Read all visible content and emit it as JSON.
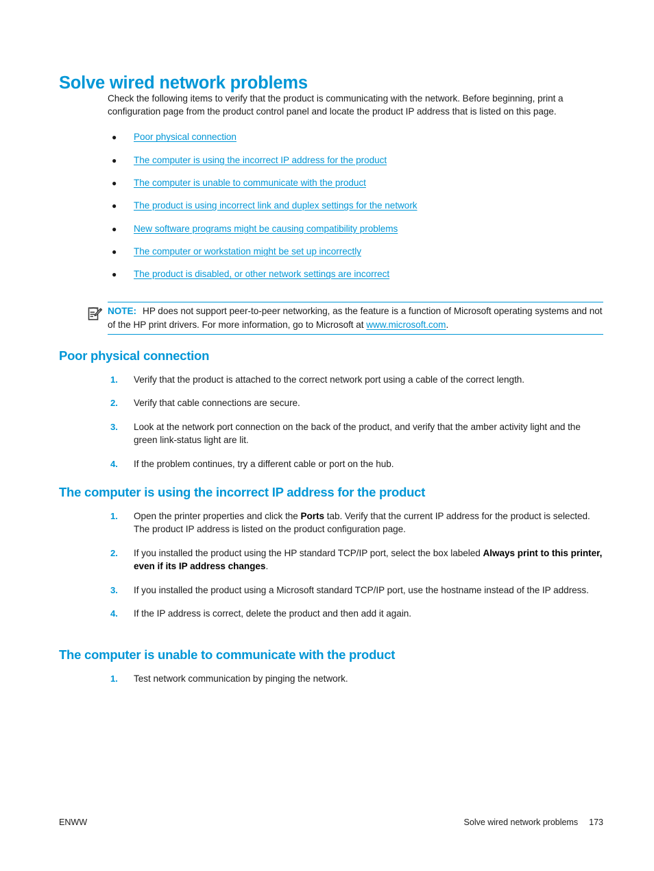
{
  "page": {
    "title": "Solve wired network problems",
    "intro": "Check the following items to verify that the product is communicating with the network. Before beginning, print a configuration page from the product control panel and locate the product IP address that is listed on this page.",
    "bullet_glyph": "●"
  },
  "link_list": [
    {
      "label": "Poor physical connection"
    },
    {
      "label": "The computer is using the incorrect IP address for the product"
    },
    {
      "label": "The computer is unable to communicate with the product"
    },
    {
      "label": "The product is using incorrect link and duplex settings for the network"
    },
    {
      "label": "New software programs might be causing compatibility problems"
    },
    {
      "label": "The computer or workstation might be set up incorrectly"
    },
    {
      "label": "The product is disabled, or other network settings are incorrect"
    }
  ],
  "note": {
    "icon": "note-pencil-icon",
    "label": "NOTE:",
    "text_part1": "HP does not support peer-to-peer networking, as the feature is a function of Microsoft operating systems and not of the HP print drivers. For more information, go to Microsoft at ",
    "link": "www.microsoft.com",
    "text_part2": "."
  },
  "sections": [
    {
      "id": "poor",
      "heading": "Poor physical connection",
      "steps": [
        {
          "num": "1.",
          "pre": "Verify that the product is attached to the correct network port using a cable of the correct length.",
          "bold": "",
          "post": ""
        },
        {
          "num": "2.",
          "pre": "Verify that cable connections are secure.",
          "bold": "",
          "post": ""
        },
        {
          "num": "3.",
          "pre": "Look at the network port connection on the back of the product, and verify that the amber activity light and the green link-status light are lit.",
          "bold": "",
          "post": ""
        },
        {
          "num": "4.",
          "pre": "If the problem continues, try a different cable or port on the hub.",
          "bold": "",
          "post": ""
        }
      ]
    },
    {
      "id": "incorrect",
      "heading": "The computer is using the incorrect IP address for the product",
      "steps": [
        {
          "num": "1.",
          "pre": "Open the printer properties and click the ",
          "bold": "Ports",
          "post": " tab. Verify that the current IP address for the product is selected. The product IP address is listed on the product configuration page."
        },
        {
          "num": "2.",
          "pre": "If you installed the product using the HP standard TCP/IP port, select the box labeled ",
          "bold": "Always print to this printer, even if its IP address changes",
          "post": "."
        },
        {
          "num": "3.",
          "pre": "If you installed the product using a Microsoft standard TCP/IP port, use the hostname instead of the IP address.",
          "bold": "",
          "post": ""
        },
        {
          "num": "4.",
          "pre": "If the IP address is correct, delete the product and then add it again.",
          "bold": "",
          "post": ""
        }
      ]
    },
    {
      "id": "unable",
      "heading": "The computer is unable to communicate with the product",
      "steps": [
        {
          "num": "1.",
          "pre": "Test network communication by pinging the network.",
          "bold": "",
          "post": ""
        }
      ]
    }
  ],
  "footer": {
    "left": "ENWW",
    "section": "Solve wired network problems",
    "page_number": "173"
  },
  "colors": {
    "accent": "#0096d6",
    "body_text": "#1a1a1a"
  }
}
